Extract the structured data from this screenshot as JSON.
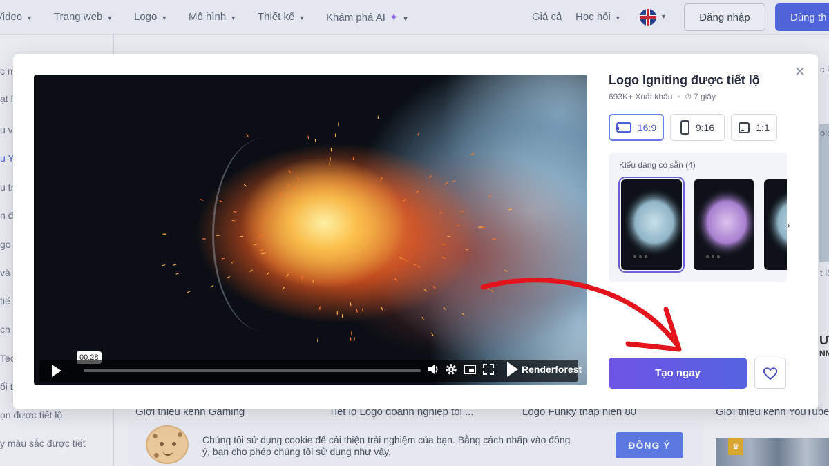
{
  "nav": {
    "items": [
      "Video",
      "Trang web",
      "Logo",
      "Mô hình",
      "Thiết kế",
      "Khám phá AI"
    ],
    "pricing": "Giá cả",
    "learn": "Học hỏi",
    "language_icon": "uk-flag-icon",
    "login": "Đăng nhập",
    "try": "Dùng th"
  },
  "sidebar_fragments": [
    "c m",
    "ạt l",
    "u và",
    "u Y",
    "u tr",
    "n đư",
    "go",
    "và",
    "tiế",
    "ch",
    "Tec",
    "ối tí",
    "ọn được tiết lộ",
    "y màu sắc được tiết"
  ],
  "background_titles": [
    "Giới thiệu kênh Gaming",
    "Tiết lộ Logo doanh nghiệp tối ...",
    "Logo Funky thập niên 80",
    "Giới thiệu kênh YouTube"
  ],
  "right_fragments": [
    "olo",
    "c k",
    "t lộ",
    "UT",
    "NNE"
  ],
  "cookie": {
    "text": "Chúng tôi sử dụng cookie để cải thiện trải nghiệm của bạn. Bằng cách nhấp vào đồng ý, bạn cho phép chúng tôi sử dụng như vậy.",
    "agree": "ĐỒNG Ý"
  },
  "modal": {
    "close_icon": "close-icon",
    "title": "Logo Igniting được tiết lộ",
    "exports": "693K+ Xuất khẩu",
    "duration": "7 giây",
    "ratios": [
      {
        "label": "16:9",
        "active": true
      },
      {
        "label": "9:16",
        "active": false
      },
      {
        "label": "1:1",
        "active": false
      }
    ],
    "styles_label": "Kiểu dáng có sẵn (4)",
    "style_colors": [
      "#9fc4d6",
      "#b892d8",
      "#9fc4d6"
    ],
    "create": "Tạo ngay",
    "favorite_icon": "heart-icon",
    "accent": "#6f54e6"
  },
  "player": {
    "time": "00:28",
    "brand": "Renderforest",
    "progress": 0.0
  }
}
